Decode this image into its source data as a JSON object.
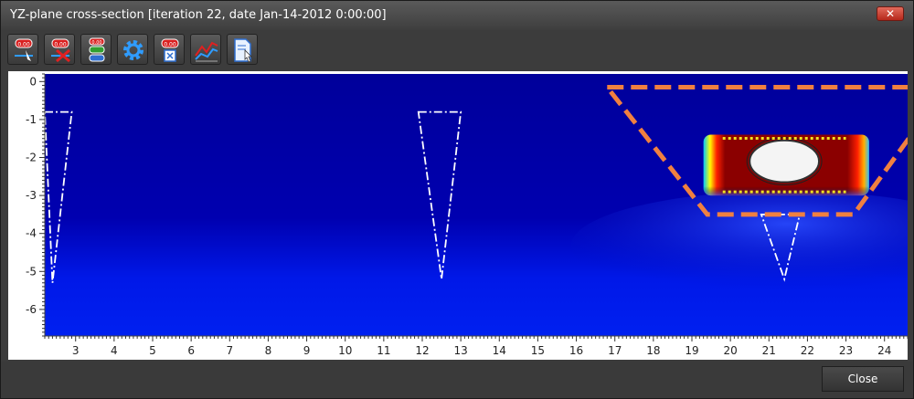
{
  "window": {
    "title": "YZ-plane cross-section [iteration 22, date Jan-14-2012 0:00:00]",
    "close_glyph": "✕"
  },
  "toolbar": {
    "buttons": [
      {
        "name": "show-values-icon",
        "label": "0.00"
      },
      {
        "name": "hide-values-icon",
        "label": "0.00"
      },
      {
        "name": "legend-icon",
        "label": "0.00"
      },
      {
        "name": "settings-gear-icon"
      },
      {
        "name": "clear-values-icon",
        "label": "0.00"
      },
      {
        "name": "line-chart-icon"
      },
      {
        "name": "document-pointer-icon"
      }
    ]
  },
  "colors": {
    "background_field": "#0000a0",
    "hot_core": "#8b0000",
    "boundary_dash": "#f08040",
    "accent_blue": "#2f9cff"
  },
  "chart_data": {
    "type": "heatmap",
    "xlim": [
      2.2,
      24.6
    ],
    "ylim": [
      -6.7,
      0.2
    ],
    "x_ticks": [
      "3",
      "4",
      "5",
      "6",
      "7",
      "8",
      "9",
      "10",
      "11",
      "12",
      "13",
      "14",
      "15",
      "16",
      "17",
      "18",
      "19",
      "20",
      "21",
      "22",
      "23",
      "24"
    ],
    "y_ticks": [
      "0",
      "-1",
      "-2",
      "-3",
      "-4",
      "-5",
      "-6"
    ],
    "triangles": [
      {
        "points": [
          [
            2.2,
            -0.8
          ],
          [
            2.9,
            -0.8
          ],
          [
            2.4,
            -5.3
          ]
        ]
      },
      {
        "points": [
          [
            11.9,
            -0.8
          ],
          [
            13.0,
            -0.8
          ],
          [
            12.5,
            -5.2
          ]
        ]
      },
      {
        "points": [
          [
            20.8,
            -3.5
          ],
          [
            21.8,
            -3.5
          ],
          [
            21.4,
            -5.2
          ]
        ]
      }
    ],
    "boundary_polygon": [
      [
        16.8,
        -0.15
      ],
      [
        24.7,
        -0.15
      ],
      [
        24.7,
        -1.4
      ],
      [
        23.2,
        -3.5
      ],
      [
        19.4,
        -3.5
      ]
    ],
    "hot_region": {
      "x": [
        19.3,
        23.6
      ],
      "y": [
        -1.4,
        -3.0
      ]
    },
    "hole": {
      "center": [
        21.4,
        -2.1
      ],
      "rx": 0.9,
      "ry": 0.55
    }
  },
  "footer": {
    "close_label": "Close"
  }
}
